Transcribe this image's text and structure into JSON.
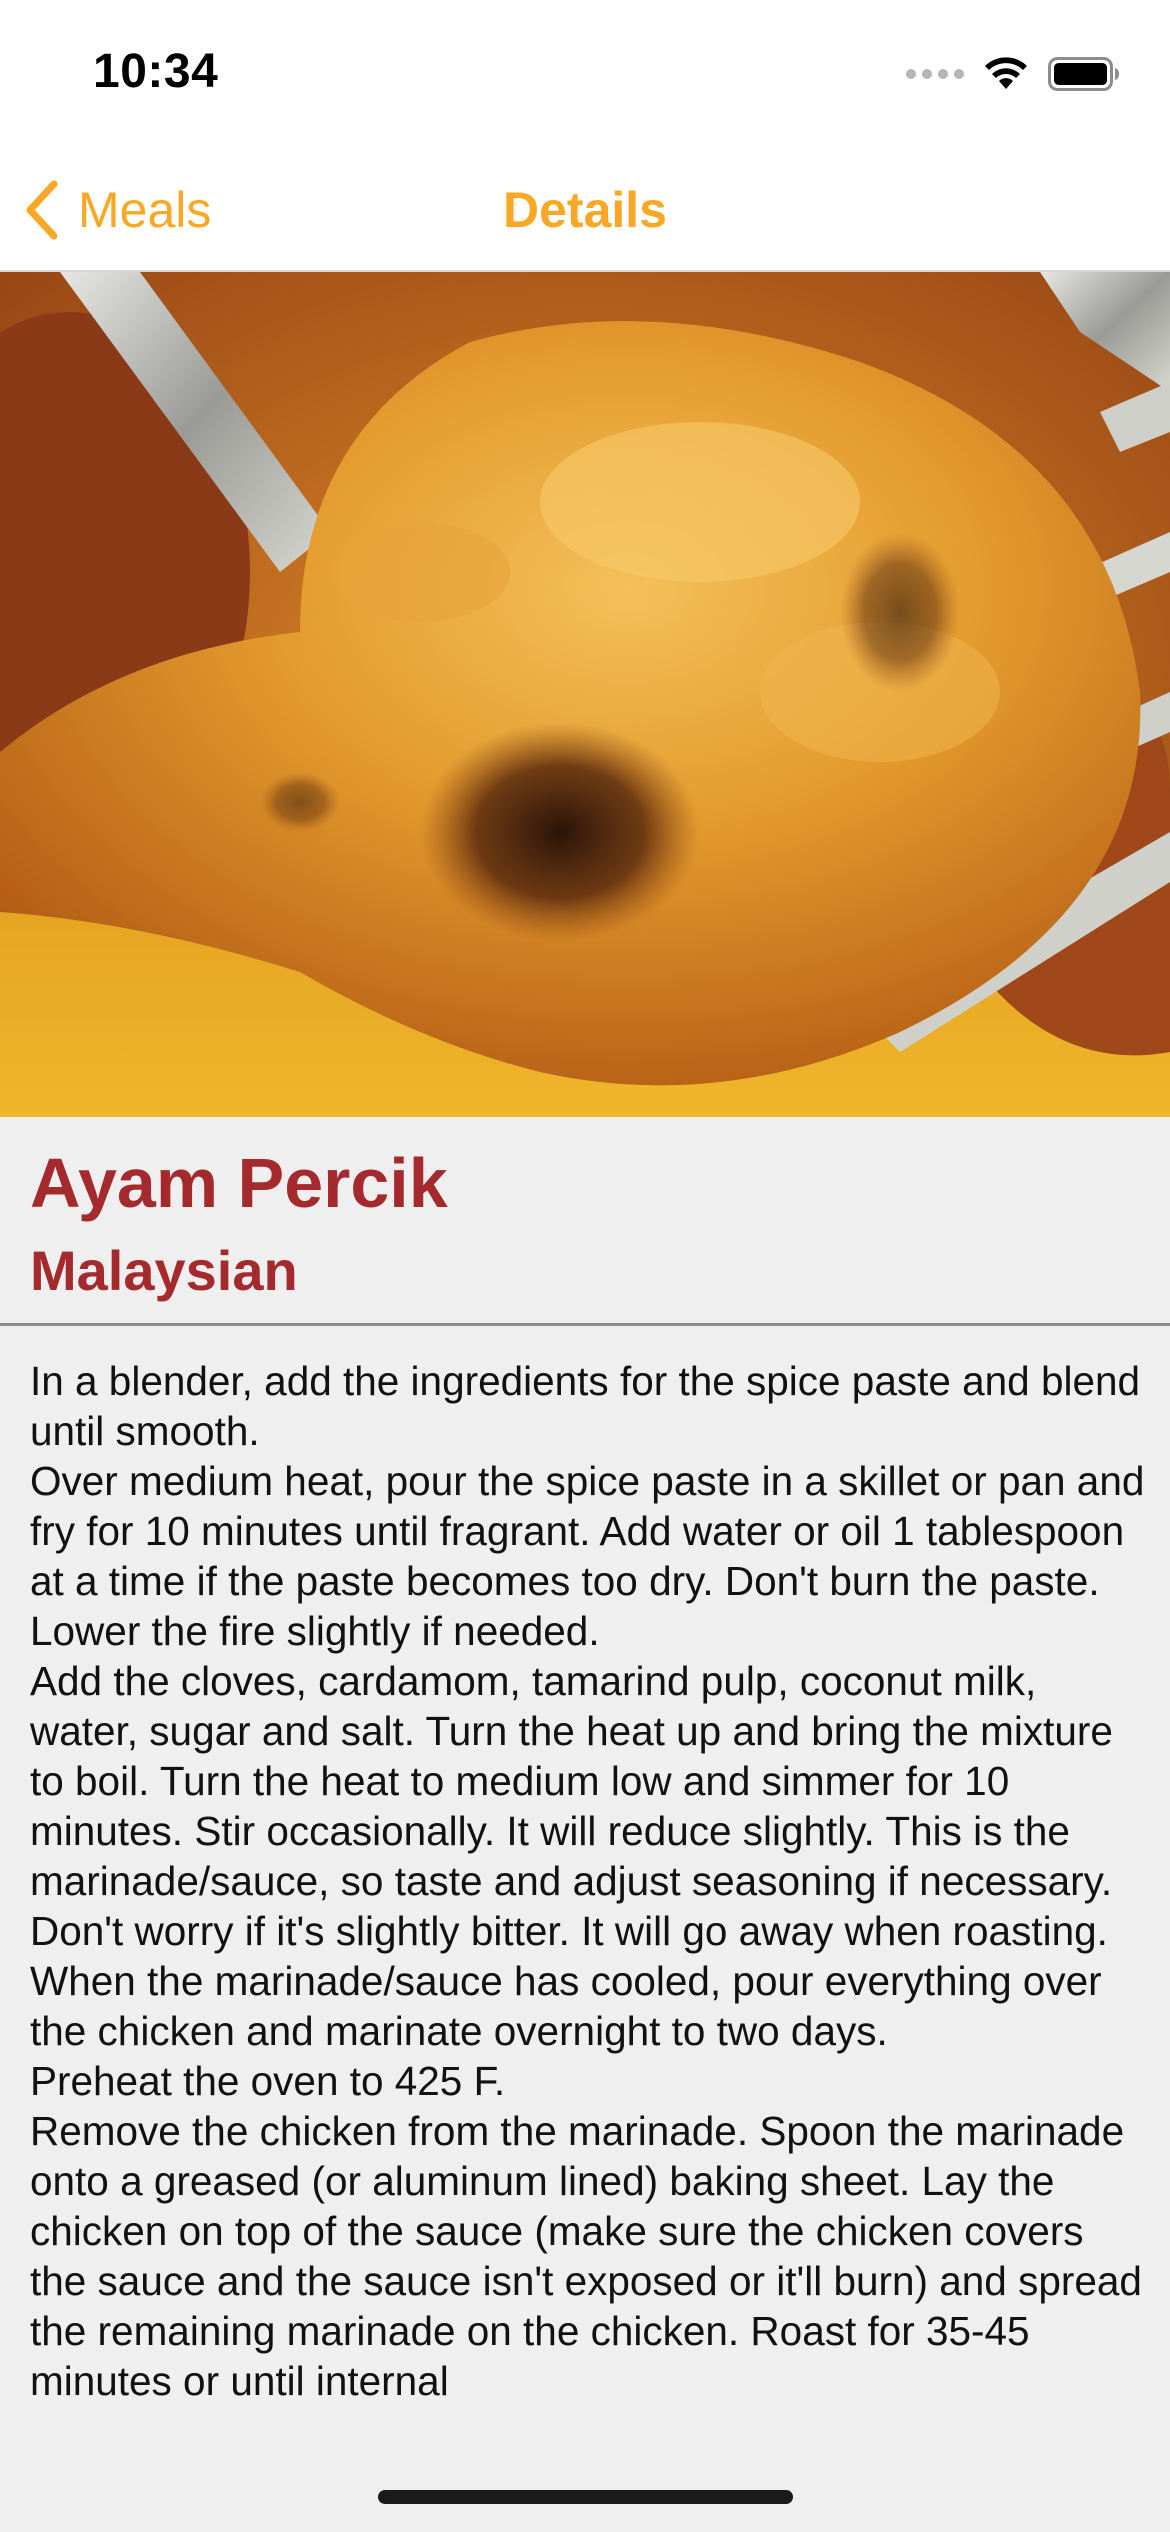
{
  "status_bar": {
    "time": "10:34",
    "icons": [
      "cellular-signal-icon",
      "wifi-icon",
      "battery-icon"
    ]
  },
  "nav": {
    "back_label": "Meals",
    "back_icon": "chevron-left-icon",
    "title": "Details",
    "accent_color": "#F9A825"
  },
  "meal": {
    "name": "Ayam Percik",
    "area": "Malaysian",
    "title_color": "#A42A2E",
    "image": "grilled-chicken-photo",
    "instructions": "In a blender, add the ingredients for the spice paste and blend until smooth.\nOver medium heat, pour the spice paste in a skillet or pan and fry for 10 minutes until fragrant. Add water or oil 1 tablespoon at a time if the paste becomes too dry. Don't burn the paste. Lower the fire slightly if needed.\nAdd the cloves, cardamom, tamarind pulp, coconut milk, water, sugar and salt. Turn the heat up and bring the mixture to boil. Turn the heat to medium low and simmer for 10 minutes. Stir occasionally. It will reduce slightly. This is the marinade/sauce, so taste and adjust seasoning if necessary. Don't worry if it's slightly bitter. It will go away when roasting.\nWhen the marinade/sauce has cooled, pour everything over the chicken and marinate overnight to two days.\nPreheat the oven to 425 F.\nRemove the chicken from the marinade. Spoon the marinade onto a greased (or aluminum lined) baking sheet. Lay the chicken on top of the sauce (make sure the chicken covers the sauce and the sauce isn't exposed or it'll burn) and spread the remaining marinade on the chicken. Roast for 35-45 minutes or until internal"
  }
}
